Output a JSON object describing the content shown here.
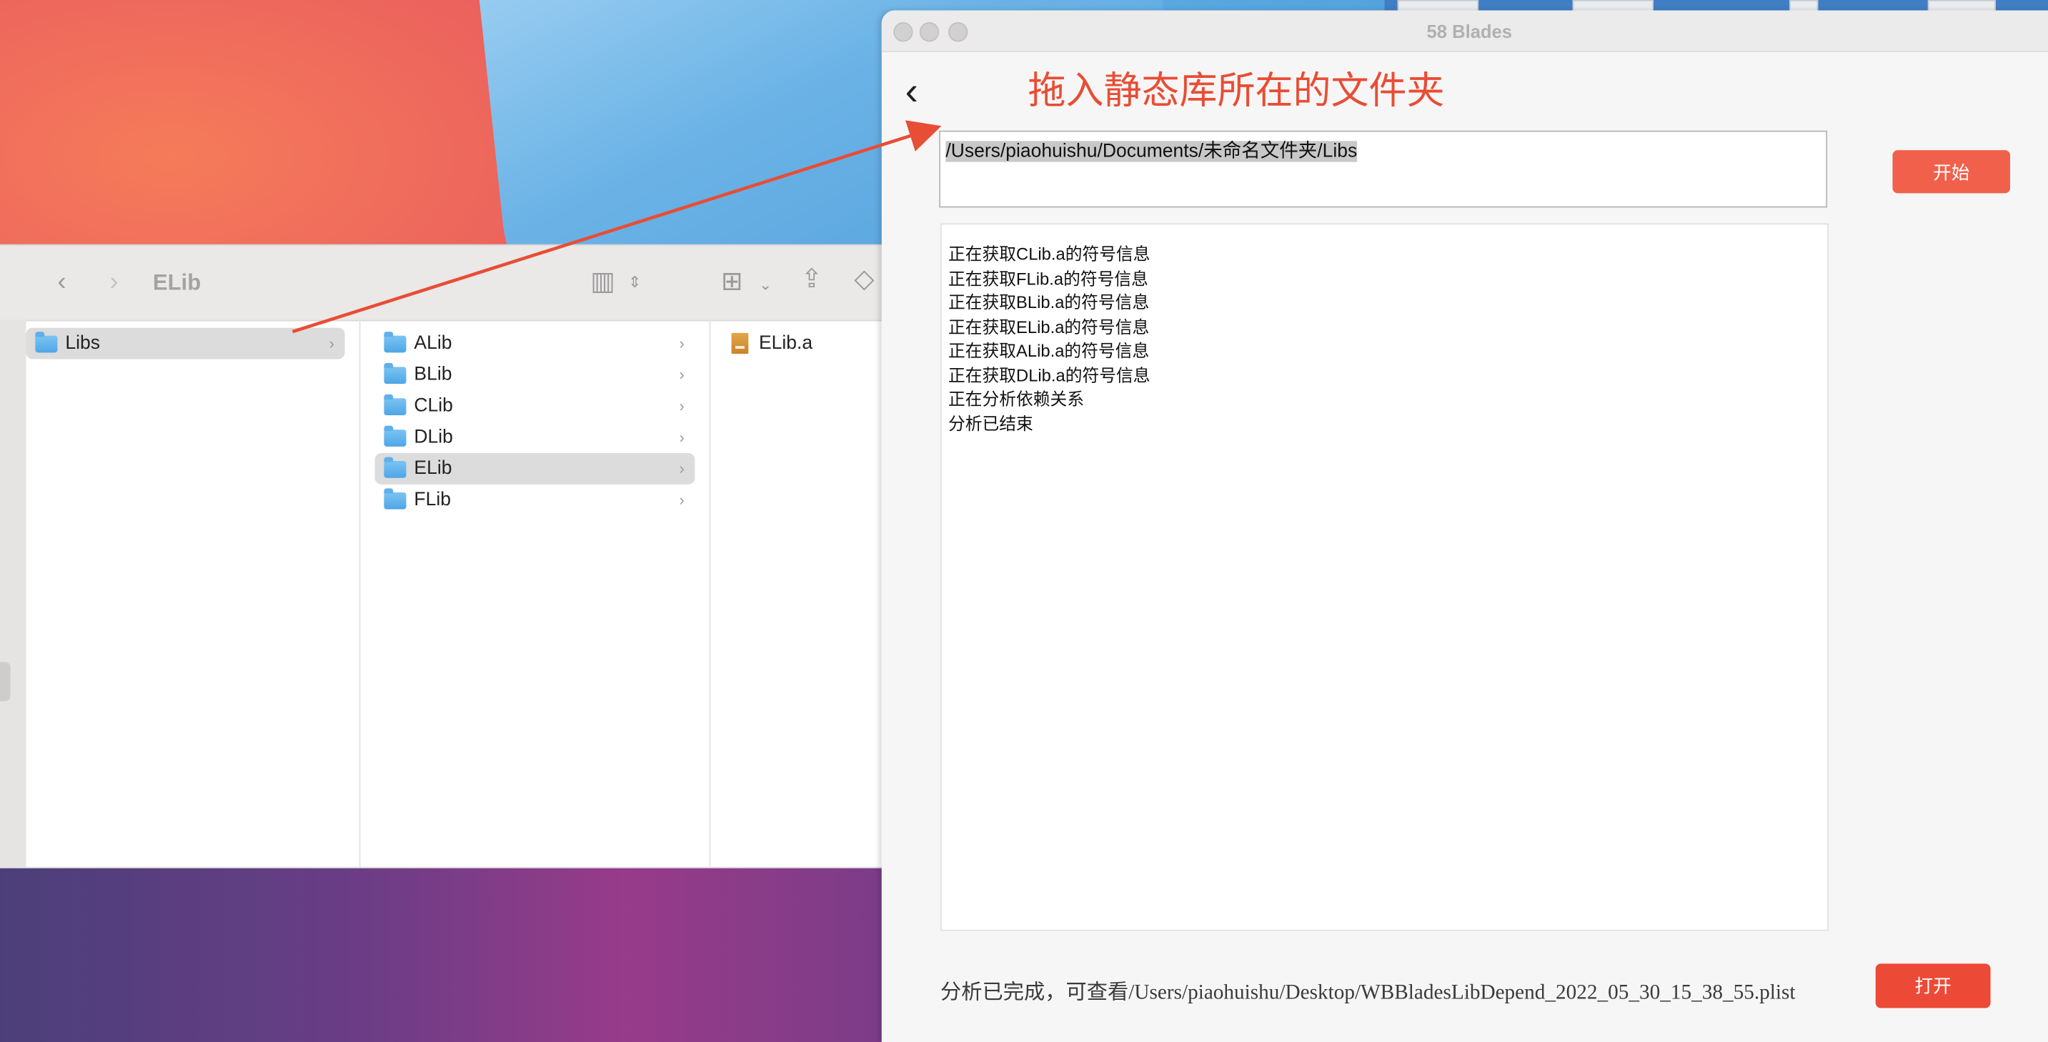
{
  "finder": {
    "title": "ELib",
    "sidebar_selected": "Libs",
    "column2": [
      "ALib",
      "BLib",
      "CLib",
      "DLib",
      "ELib",
      "FLib"
    ],
    "column2_selected": "ELib",
    "column3": [
      "ELib.a"
    ]
  },
  "blades": {
    "window_title": "58 Blades",
    "annotation": "拖入静态库所在的文件夹",
    "path_value": "/Users/piaohuishu/Documents/未命名文件夹/Libs",
    "start_label": "开始",
    "log_lines": [
      "正在获取CLib.a的符号信息",
      "正在获取FLib.a的符号信息",
      "正在获取BLib.a的符号信息",
      "正在获取ELib.a的符号信息",
      "正在获取ALib.a的符号信息",
      "正在获取DLib.a的符号信息",
      "正在分析依赖关系",
      "分析已结束"
    ],
    "status_text": "分析已完成，可查看/Users/piaohuishu/Desktop/WBBladesLibDepend_2022_05_30_15_38_55.plist",
    "open_label": "打开"
  },
  "colors": {
    "accent": "#f0604a",
    "annotation": "#e84d35"
  }
}
